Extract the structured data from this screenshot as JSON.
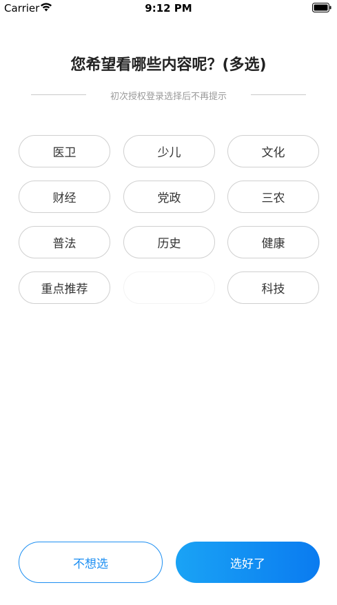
{
  "status_bar": {
    "carrier": "Carrier",
    "time": "9:12 PM",
    "wifi_icon": "wifi-icon",
    "battery_icon": "battery-icon"
  },
  "title": "您希望看哪些内容呢？(多选)",
  "subtitle": "初次授权登录选择后不再提示",
  "tags": [
    {
      "label": "医卫"
    },
    {
      "label": "少儿"
    },
    {
      "label": "文化"
    },
    {
      "label": "财经"
    },
    {
      "label": "党政"
    },
    {
      "label": "三农"
    },
    {
      "label": "普法"
    },
    {
      "label": "历史"
    },
    {
      "label": "健康"
    },
    {
      "label": "重点推荐"
    },
    {
      "label": ""
    },
    {
      "label": "科技"
    }
  ],
  "buttons": {
    "skip_label": "不想选",
    "done_label": "选好了"
  },
  "colors": {
    "accent": "#1b8ef2",
    "gradient_start": "#1aa3f5",
    "gradient_end": "#0a7bf0",
    "tag_border": "#cfcfcf",
    "subtitle": "#9a9a9a"
  }
}
